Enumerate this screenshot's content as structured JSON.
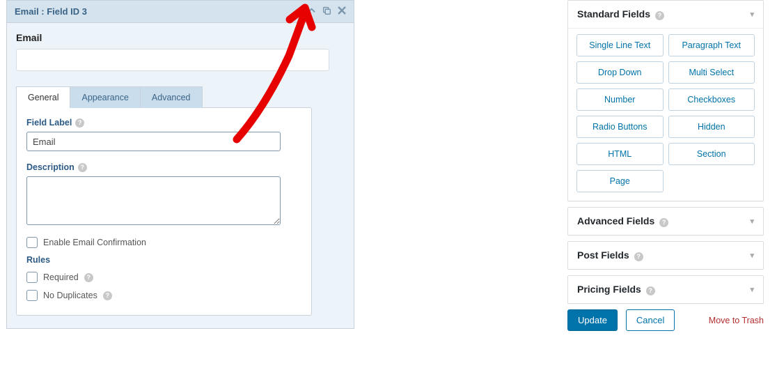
{
  "field": {
    "header_title": "Email : Field ID 3",
    "display_label": "Email",
    "display_value": ""
  },
  "tabs": {
    "general": "General",
    "appearance": "Appearance",
    "advanced": "Advanced"
  },
  "settings": {
    "field_label_title": "Field Label",
    "field_label_value": "Email",
    "description_title": "Description",
    "description_value": "",
    "enable_confirm_label": "Enable Email Confirmation",
    "rules_header": "Rules",
    "required_label": "Required",
    "no_duplicates_label": "No Duplicates"
  },
  "sidebar": {
    "standard": {
      "title": "Standard Fields",
      "fields": [
        "Single Line Text",
        "Paragraph Text",
        "Drop Down",
        "Multi Select",
        "Number",
        "Checkboxes",
        "Radio Buttons",
        "Hidden",
        "HTML",
        "Section",
        "Page"
      ]
    },
    "advanced": {
      "title": "Advanced Fields"
    },
    "post": {
      "title": "Post Fields"
    },
    "pricing": {
      "title": "Pricing Fields"
    }
  },
  "actions": {
    "update": "Update",
    "cancel": "Cancel",
    "trash": "Move to Trash"
  }
}
